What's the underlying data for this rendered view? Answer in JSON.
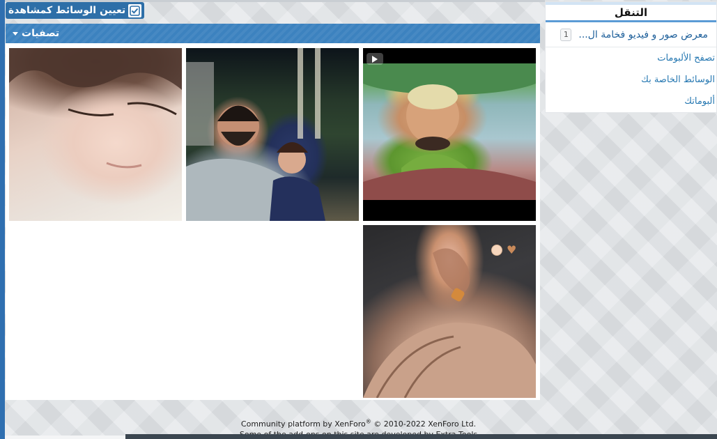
{
  "mark_viewed": {
    "label": "تعيين الوسائط كمشاهدة"
  },
  "filter": {
    "label": "تصفيات"
  },
  "media_items": [
    {
      "kind": "image",
      "subject": "girl-closeup"
    },
    {
      "kind": "image",
      "subject": "man-and-child"
    },
    {
      "kind": "video",
      "subject": "animated-character",
      "icon": "youtube-icon"
    },
    {
      "kind": "image",
      "subject": "hair-clip",
      "emoji": "🥺🤎"
    }
  ],
  "navigation": {
    "title": "التنقل",
    "primary": {
      "label": "معرض صور و فيديو فخامة ال...",
      "count": "1"
    },
    "links": [
      {
        "label": "تصفح الألبومات"
      },
      {
        "label": "الوسائط الخاصة بك"
      },
      {
        "label": "ألبوماتك"
      }
    ]
  },
  "footer": {
    "line1_a": "Community platform by XenForo",
    "line1_sup": "®",
    "line1_b": " © 2010-2022 XenForo Ltd.",
    "line2": "Some of the add-ons on this site are developed by Extra Tools"
  },
  "colors": {
    "accent": "#2e6fa8",
    "filter_bar": "#3c82bf",
    "link": "#2577b1"
  }
}
